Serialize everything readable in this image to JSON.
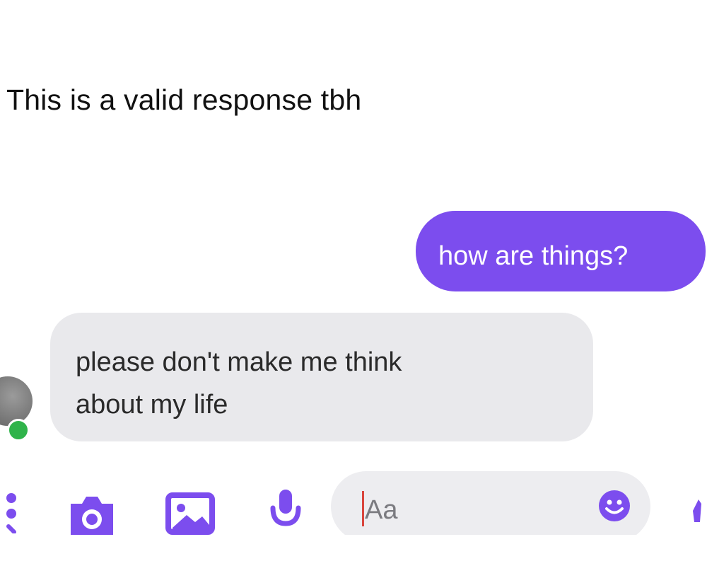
{
  "post": {
    "caption": "This is a valid response tbh"
  },
  "chat": {
    "messages": [
      {
        "direction": "outgoing",
        "text": "how are things?"
      },
      {
        "direction": "incoming",
        "lines": [
          "please don't make me think",
          "about my life"
        ]
      }
    ],
    "contact": {
      "online": true
    }
  },
  "composer": {
    "placeholder": "Aa",
    "icons": [
      "more-icon",
      "camera-icon",
      "image-icon",
      "mic-icon",
      "emoji-icon",
      "like-icon"
    ]
  },
  "colors": {
    "accent": "#7c4dee",
    "incoming_bubble": "#e9e9ec",
    "online": "#2fb34a",
    "input_background": "#ededf0"
  }
}
